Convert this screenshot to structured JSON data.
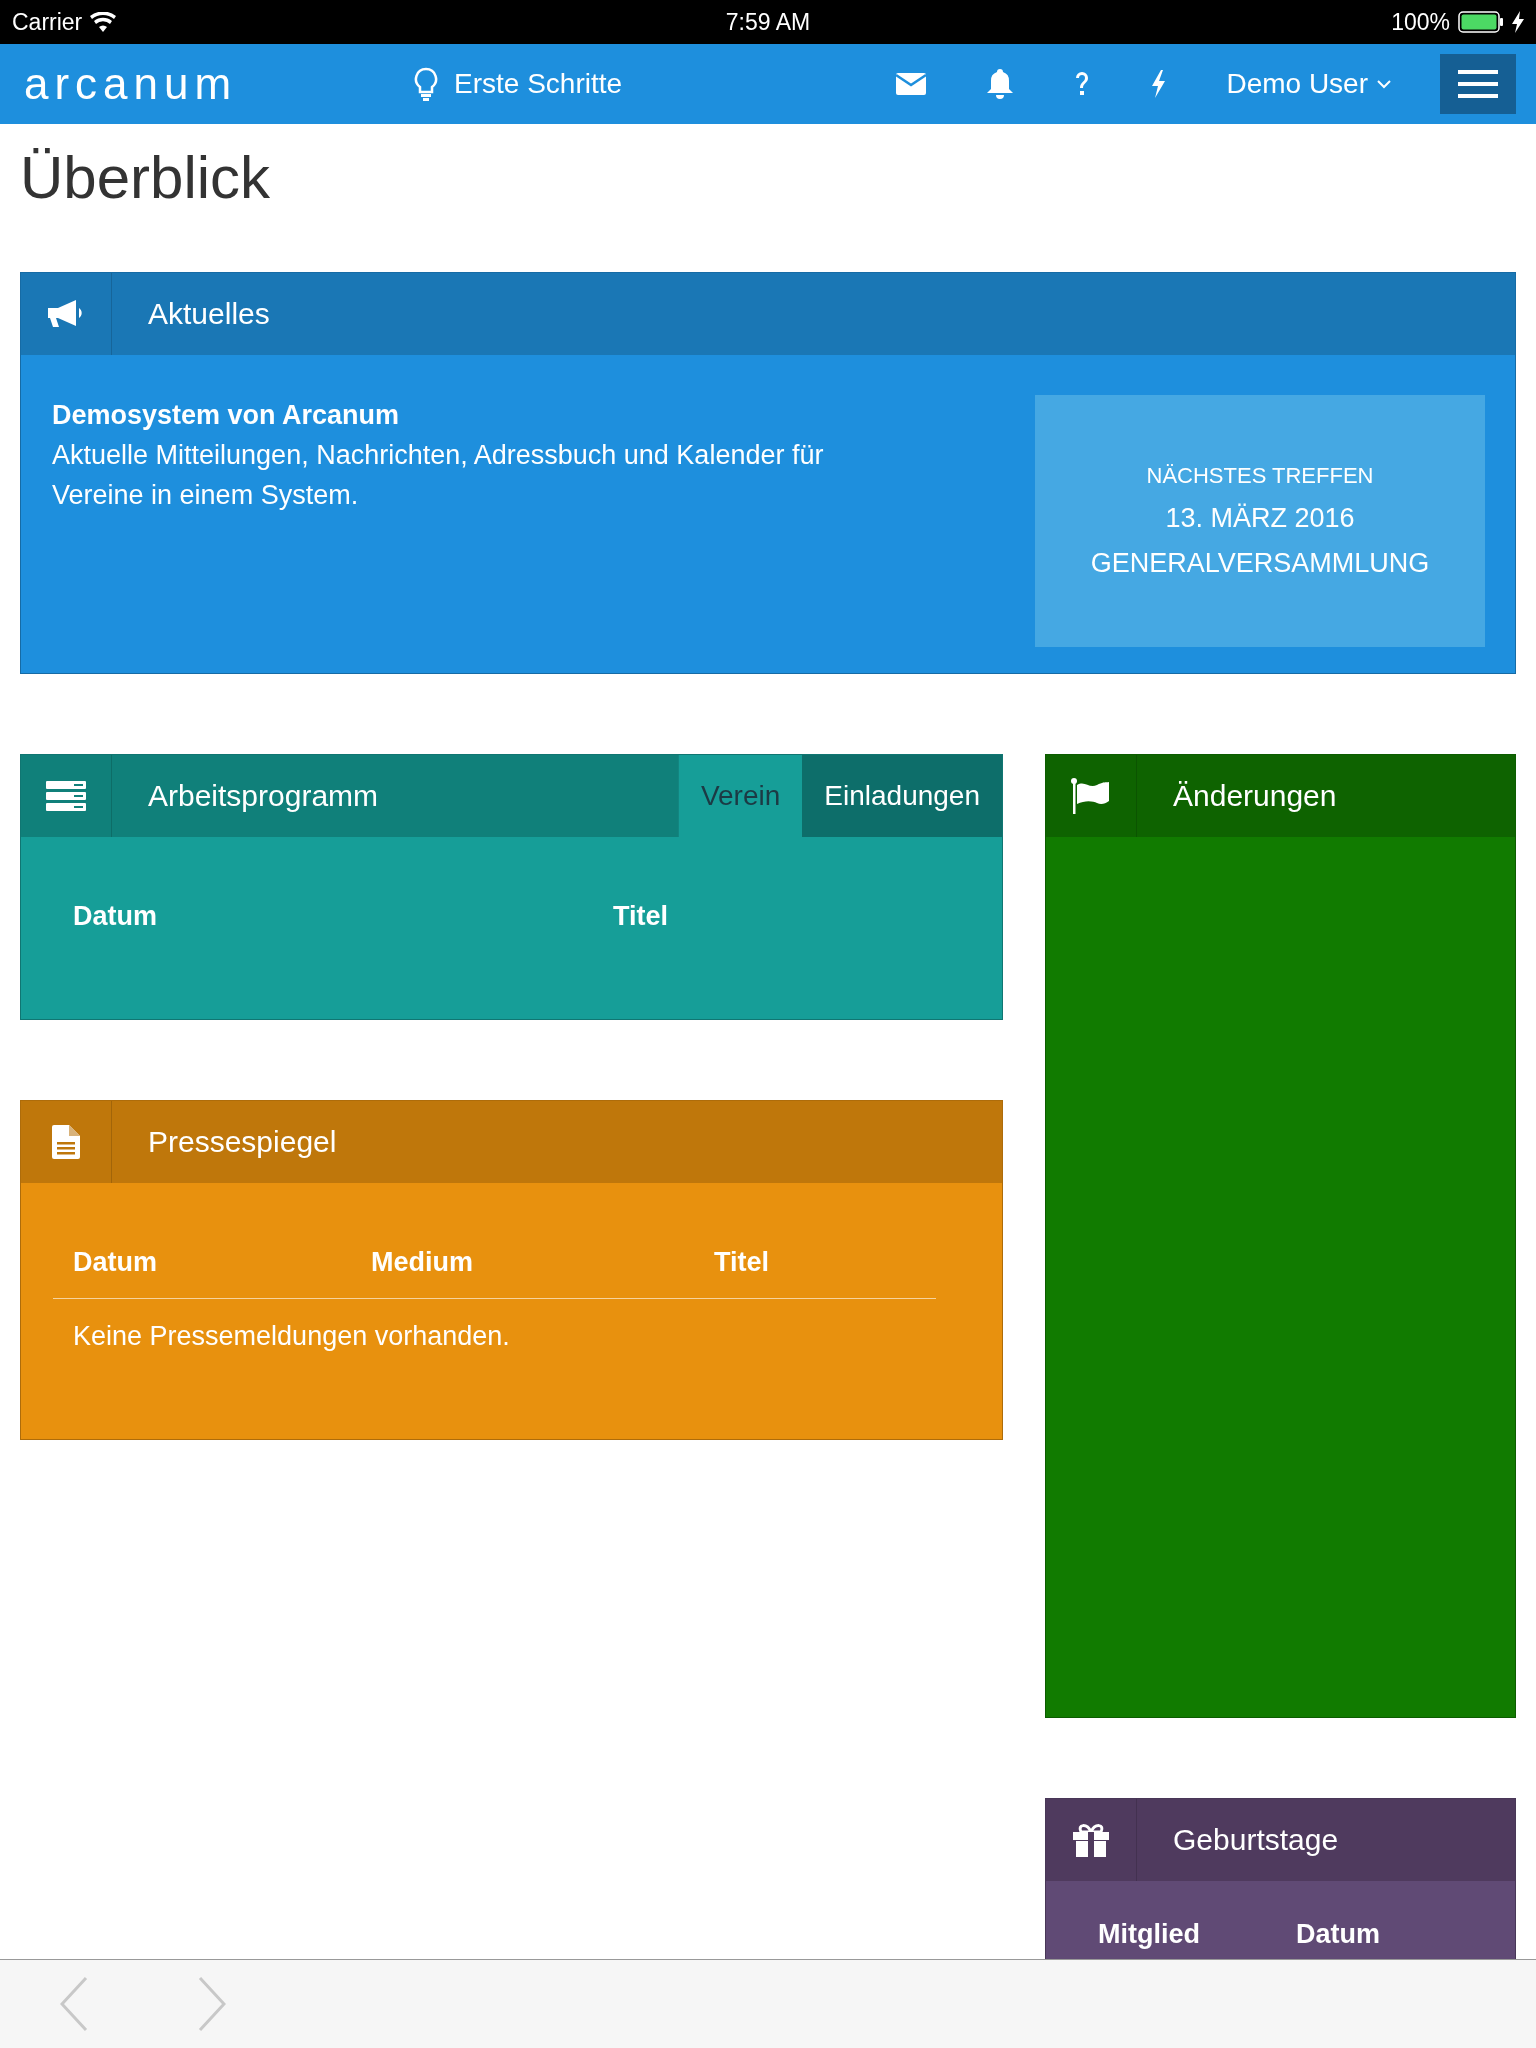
{
  "status_bar": {
    "carrier": "Carrier",
    "time": "7:59 AM",
    "battery": "100%"
  },
  "nav": {
    "logo": "arcanum",
    "getting_started": "Erste Schritte",
    "user": "Demo User"
  },
  "page_title": "Überblick",
  "news": {
    "title": "Aktuelles",
    "headline": "Demosystem von Arcanum",
    "text": "Aktuelle Mitteilungen, Nachrichten, Adressbuch und Kalender für Vereine in einem System.",
    "next_meeting": {
      "label": "NÄCHSTES TREFFEN",
      "date": "13. MÄRZ 2016",
      "name": "GENERALVERSAMMLUNG"
    }
  },
  "work_program": {
    "title": "Arbeitsprogramm",
    "tabs": [
      {
        "label": "Verein",
        "selected": true
      },
      {
        "label": "Einladungen",
        "selected": false
      }
    ],
    "columns": [
      "Datum",
      "Titel"
    ]
  },
  "press": {
    "title": "Pressespiegel",
    "columns": [
      "Datum",
      "Medium",
      "Titel"
    ],
    "empty_message": "Keine Pressemeldungen vorhanden."
  },
  "changes": {
    "title": "Änderungen"
  },
  "birthdays": {
    "title": "Geburtstage",
    "columns": [
      "Mitglied",
      "Datum"
    ]
  },
  "browser_toolbar": {
    "back": {
      "disabled": true
    },
    "forward": {
      "disabled": true
    }
  }
}
